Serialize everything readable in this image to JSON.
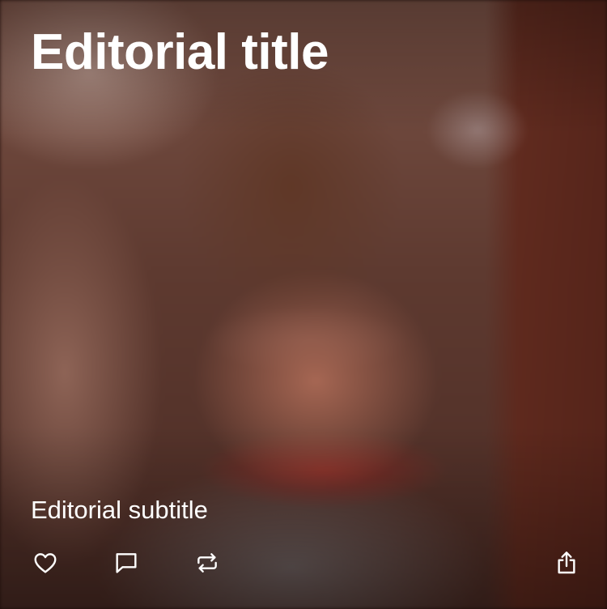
{
  "post": {
    "title": "Editorial title",
    "subtitle": "Editorial subtitle"
  },
  "actions": [
    {
      "name": "like",
      "icon": "heart-icon"
    },
    {
      "name": "comment",
      "icon": "speech-bubble-icon"
    },
    {
      "name": "repost",
      "icon": "repost-arrows-icon"
    },
    {
      "name": "share",
      "icon": "share-upload-icon"
    }
  ],
  "colors": {
    "text": "#ffffff",
    "icon": "#ffffff"
  }
}
